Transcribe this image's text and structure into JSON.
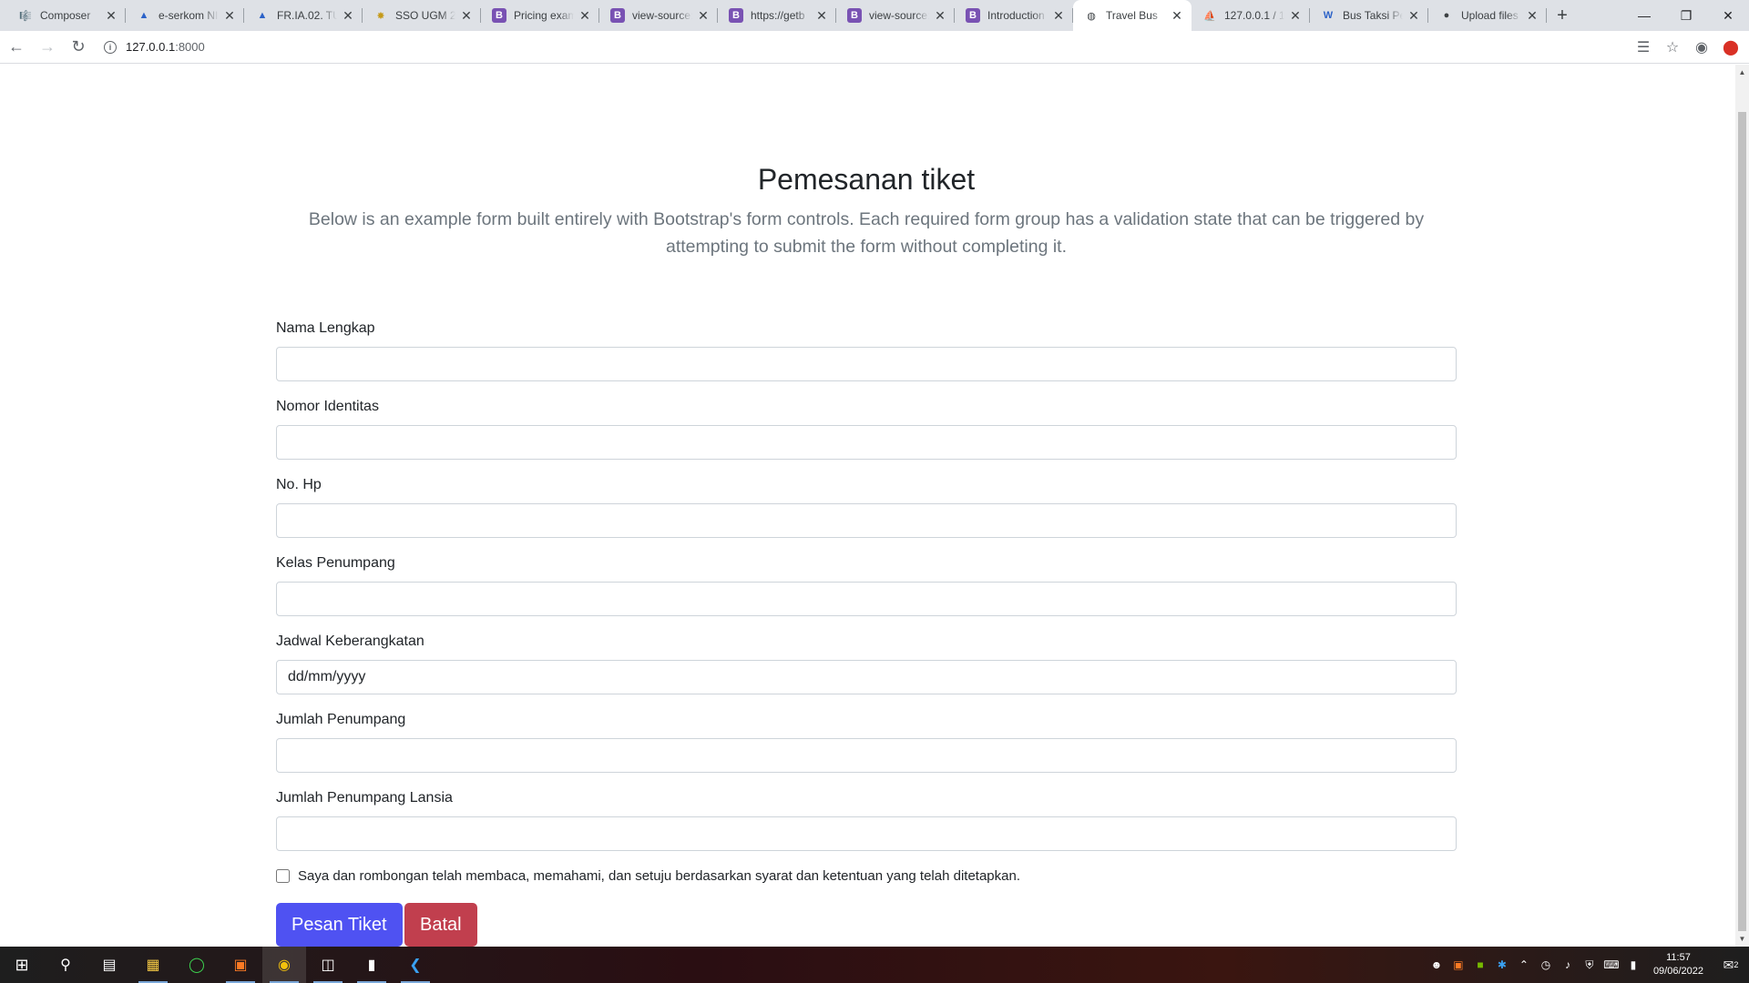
{
  "browser": {
    "tabs": [
      {
        "title": "Composer",
        "icon": "composer-icon",
        "glyph": "🎼"
      },
      {
        "title": "e-serkom NI",
        "icon": "triangle-icon",
        "glyph": "▲"
      },
      {
        "title": "FR.IA.02. TU",
        "icon": "triangle-icon",
        "glyph": "▲"
      },
      {
        "title": "SSO UGM 2",
        "icon": "sun-icon",
        "glyph": "✸"
      },
      {
        "title": "Pricing exam",
        "icon": "bootstrap-icon",
        "glyph": "B"
      },
      {
        "title": "view-source:",
        "icon": "bootstrap-icon",
        "glyph": "B"
      },
      {
        "title": "https://getb",
        "icon": "bootstrap-icon",
        "glyph": "B"
      },
      {
        "title": "view-source:",
        "icon": "bootstrap-icon",
        "glyph": "B"
      },
      {
        "title": "Introduction",
        "icon": "bootstrap-icon",
        "glyph": "B"
      },
      {
        "title": "Travel Bus",
        "icon": "globe-icon",
        "glyph": "◍",
        "active": true
      },
      {
        "title": "127.0.0.1 / 1",
        "icon": "phpmyadmin-icon",
        "glyph": "⛵"
      },
      {
        "title": "Bus Taksi Pe",
        "icon": "wordpress-icon",
        "glyph": "W"
      },
      {
        "title": "Upload files",
        "icon": "github-icon",
        "glyph": "●"
      }
    ],
    "url_host": "127.0.0.1",
    "url_port": ":8000"
  },
  "page": {
    "title": "Pemesanan tiket",
    "lead": "Below is an example form built entirely with Bootstrap's form controls. Each required form group has a validation state that can be triggered by attempting to submit the form without completing it.",
    "fields": {
      "nama": {
        "label": "Nama Lengkap",
        "value": ""
      },
      "identitas": {
        "label": "Nomor Identitas",
        "value": ""
      },
      "hp": {
        "label": "No. Hp",
        "value": ""
      },
      "kelas": {
        "label": "Kelas Penumpang",
        "value": ""
      },
      "jadwal": {
        "label": "Jadwal Keberangkatan",
        "placeholder": "dd/mm/yyyy"
      },
      "jumlah": {
        "label": "Jumlah Penumpang",
        "value": ""
      },
      "lansia": {
        "label": "Jumlah Penumpang Lansia",
        "value": ""
      }
    },
    "agreement": "Saya dan rombongan telah membaca, memahami, dan setuju berdasarkan syarat dan ketentuan yang telah ditetapkan.",
    "agreement_checked": false,
    "submit_label": "Pesan Tiket",
    "cancel_label": "Batal"
  },
  "taskbar": {
    "time": "11:57",
    "date": "09/06/2022",
    "notification_count": "2"
  },
  "colors": {
    "primary_button": "#4f52f2",
    "danger_button": "#c13f4e"
  }
}
